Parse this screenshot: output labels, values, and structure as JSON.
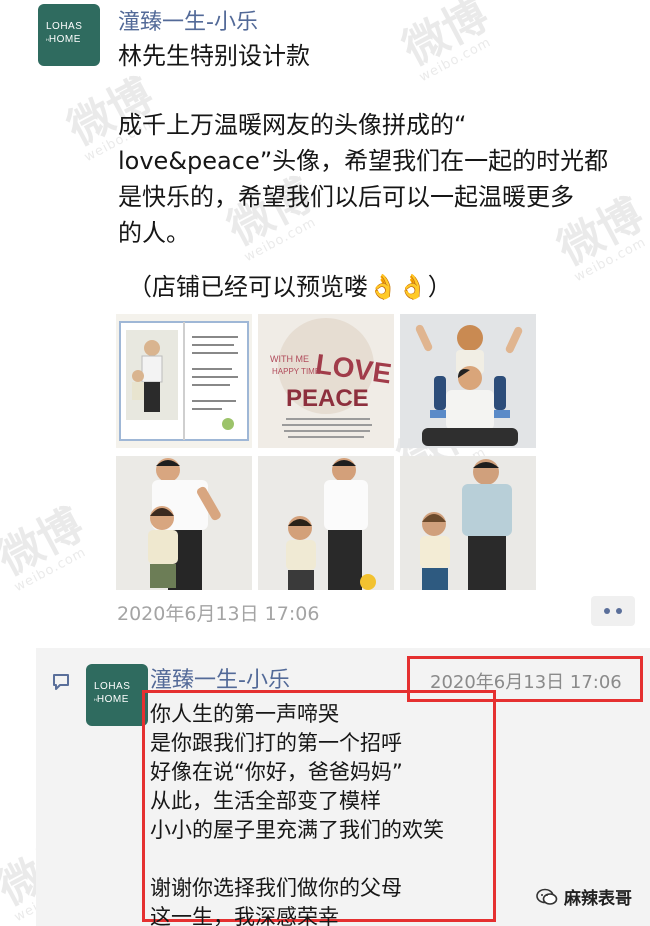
{
  "post": {
    "author": "潼臻一生-小乐",
    "avatar_text": [
      "LOHAS",
      "HOME"
    ],
    "subtitle": "林先生特别设计款",
    "body_lines": [
      "成千上万温暖网友的头像拼成的“",
      "love&peace”头像，希望我们在一起的时光都",
      "是快乐的，希望我们以后可以一起温暖更多",
      "的人。"
    ],
    "note": "（店铺已经可以预览喽👌👌）",
    "timestamp": "2020年6月13日 17:06",
    "photos": [
      "photo-book",
      "photo-love-peace-tee",
      "photo-shoulder-ride",
      "photo-father-daughter",
      "photo-walking",
      "photo-father-son"
    ],
    "photo_texts": {
      "love_word": "LOVE",
      "peace_word": "PEACE",
      "with_me": "WITH ME",
      "happy_time": "HAPPY TIME"
    }
  },
  "comment": {
    "author": "潼臻一生-小乐",
    "timestamp": "2020年6月13日 17:06",
    "lines": [
      "你人生的第一声啼哭",
      "是你跟我们打的第一个招呼",
      "好像在说“你好，爸爸妈妈”",
      "从此，生活全部变了模样",
      "小小的屋子里充满了我们的欢笑",
      "",
      "谢谢你选择我们做你的父母",
      "这一生，我深感荣幸"
    ]
  },
  "watermark": {
    "main": "微博",
    "sub": "weibo.com"
  },
  "brand_tag": "麻辣表哥",
  "colors": {
    "name": "#536a98",
    "highlight": "#e53030",
    "avatar": "#2f6b5f"
  }
}
